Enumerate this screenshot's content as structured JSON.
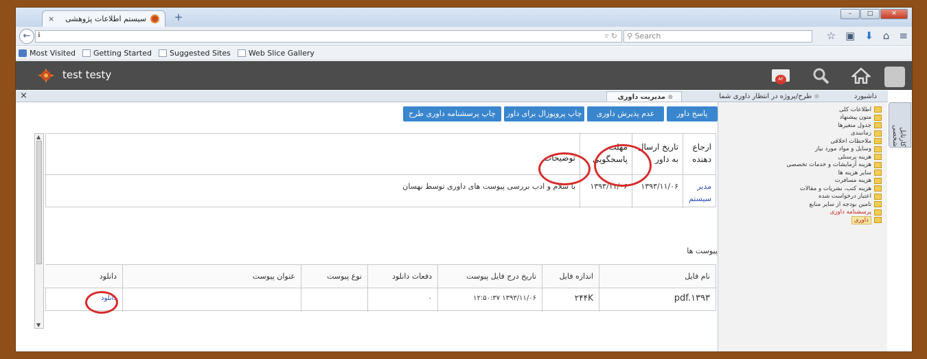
{
  "browser": {
    "tab_title": "سیستم اطلاعات پژوهشی",
    "tab_close": "×",
    "new_tab": "+",
    "back": "←",
    "search_placeholder": "Search",
    "bookmarks": [
      "Most Visited",
      "Getting Started",
      "Suggested Sites",
      "Web Slice Gallery"
    ]
  },
  "app": {
    "user_name": "test testy",
    "mail_badge": "AF",
    "tabs": [
      "داشبورد",
      "طرح/پروژه در انتظار داوری شما",
      "مدیریت داوری"
    ],
    "close": "×",
    "side_tab": "کارتابل شخصی"
  },
  "tree": {
    "items": [
      "اطلاعات کلی",
      "متون پیشنهاد",
      "جدول متغیرها",
      "زمانبندی",
      "ملاحظات اخلاقی",
      "وسایل و مواد مورد نیاز",
      "هزینه پرسنلی",
      "هزینه آزمایشات و خدمات تخصصی",
      "سایر هزینه ها",
      "هزینه مسافرت",
      "هزینه کتب، نشریات و مقالات",
      "اعتبار درخواست شده",
      "تامین بودجه از سایر منابع",
      "پرسشنامه داوری",
      "داوری"
    ]
  },
  "toolbar": {
    "respond": "پاسخ داور",
    "reject": "عدم پذیرش داوری",
    "print_proposal": "چاپ پروپوزال برای داور",
    "print_questionnaire": "چاپ پرسشنامه داوری طرح"
  },
  "referral_table": {
    "headers": [
      "ارجاع دهنده",
      "تاریخ ارسال به داور",
      "مهلت پاسخگویی",
      "توضیحات"
    ],
    "row": {
      "referrer": "مدیر سیستم",
      "sent_date": "۱۳۹۳/۱۱/۰۶",
      "deadline": "۱۳۹۳/۱۱/۰۶",
      "description": "با سلام و ادب بررسی پیوست های داوری توسط بهسان"
    }
  },
  "attachments": {
    "label": "پیوست ها",
    "headers": [
      "نام فایل",
      "اندازه فایل",
      "تاریخ درج فایل پیوست",
      "دفعات دانلود",
      "نوع پیوست",
      "عنوان پیوست",
      "دانلود"
    ],
    "row": {
      "file_name": "pdf.۱۳۹۳",
      "size": "۲۴۴K",
      "date": "۱۳۹۳/۱۱/۰۶   ۱۲:۵۰:۳۷",
      "downloads": "۰",
      "type": "",
      "title": "",
      "download": "دانلود"
    }
  },
  "colors": {
    "frame": "#8f4f19",
    "header": "#4c4c4c",
    "button": "#3a86ce",
    "highlight": "#d62c2a"
  }
}
